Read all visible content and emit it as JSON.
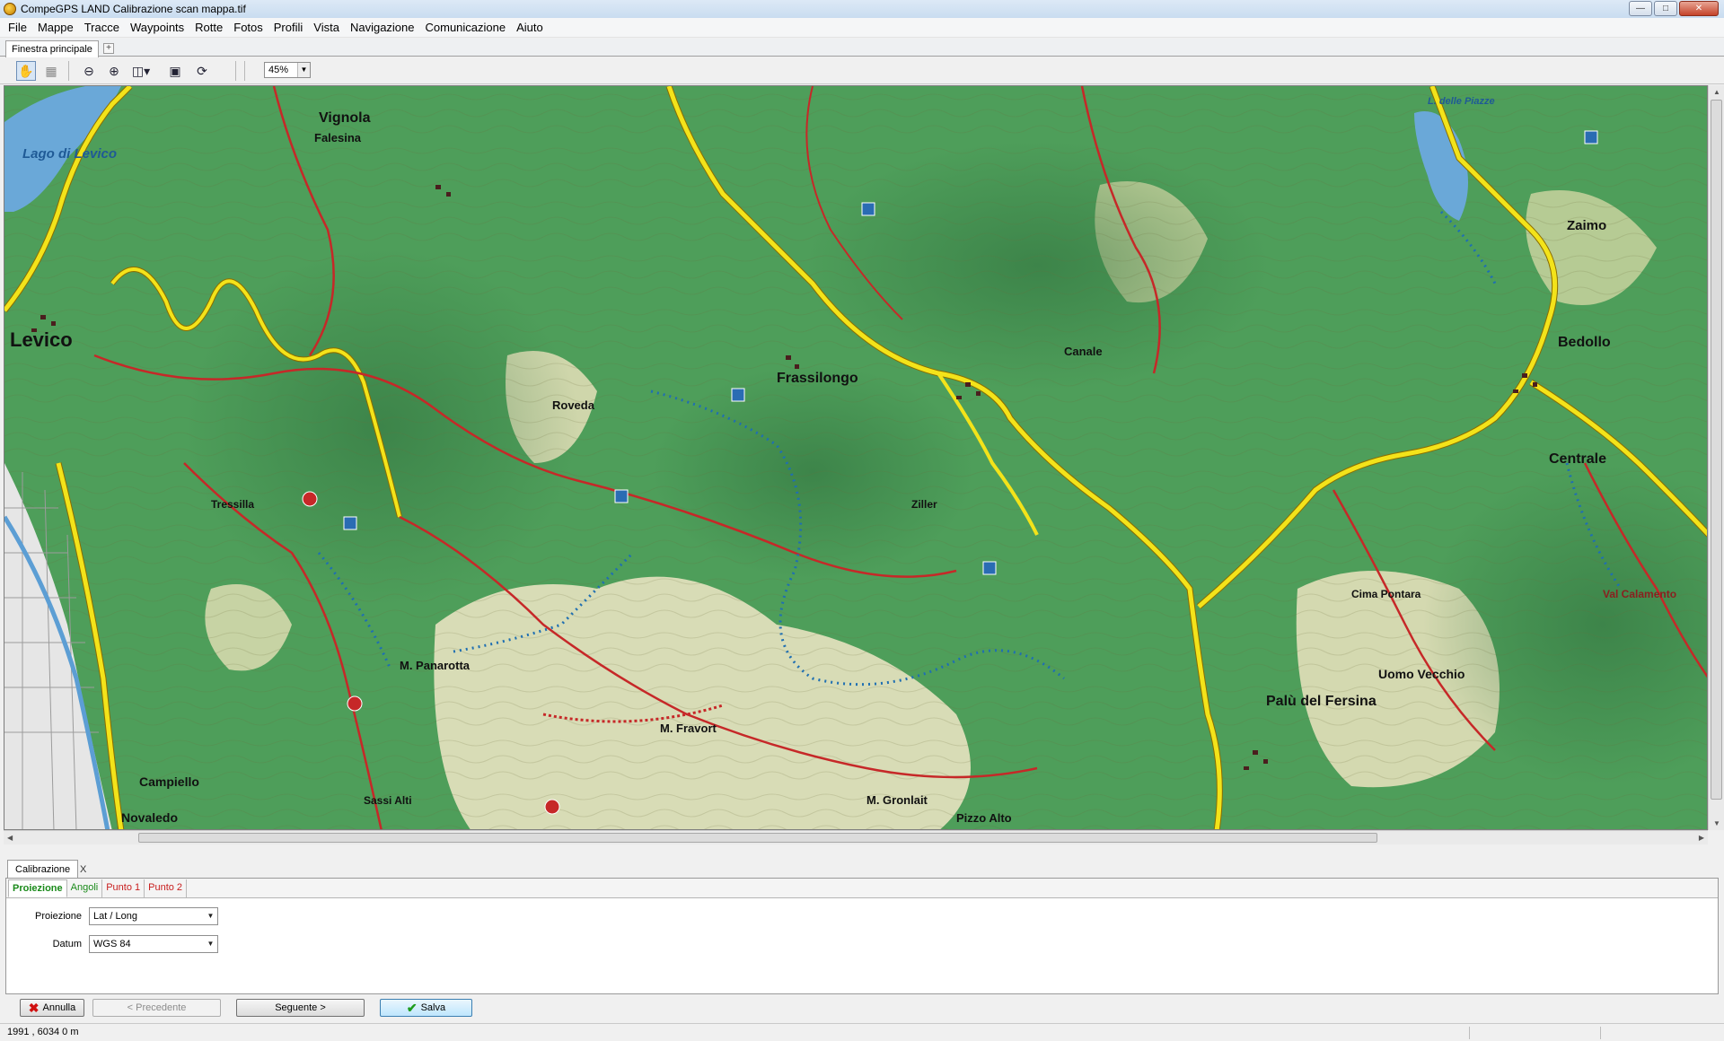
{
  "window": {
    "title": "CompeGPS LAND Calibrazione scan mappa.tif",
    "controls": [
      "minimize-icon",
      "maximize-icon",
      "close-icon"
    ]
  },
  "menu": [
    "File",
    "Mappe",
    "Tracce",
    "Waypoints",
    "Rotte",
    "Fotos",
    "Profili",
    "Vista",
    "Navigazione",
    "Comunicazione",
    "Aiuto"
  ],
  "main_tab": {
    "label": "Finestra principale",
    "add_label": "+"
  },
  "toolbar": {
    "zoom_value": "45%",
    "tools": [
      "hand-pan-icon",
      "select-icon",
      "zoom-out-icon",
      "zoom-in-icon",
      "zoom-window-icon",
      "map-view-icon",
      "refresh-icon"
    ]
  },
  "map": {
    "colors": {
      "forest": "#4e9e5a",
      "meadow": "#d9ddb6",
      "road": "#f3e31a",
      "trail": "#c62828",
      "path": "#1f6fb2",
      "water": "#6aa8d8"
    },
    "labels": [
      "Levico",
      "Lago di Levico",
      "Vignola",
      "Falesina",
      "Frassilongo",
      "Roveda",
      "Palù del Fersina",
      "Centrale",
      "Bedollo",
      "Zaimo",
      "M. Panarotta",
      "M. Fravort",
      "M. Gronlait",
      "Campiello",
      "Novaledo",
      "Uomo Vecchio",
      "Sassi Alti",
      "Canale",
      "Pizzo Alto",
      "Cima Pontara",
      "Val Calamento",
      "L. delle Piazze",
      "Ziller",
      "Tressilla"
    ]
  },
  "panel": {
    "tab_label": "Calibrazione",
    "close_label": "X",
    "subtabs": [
      "Proiezione",
      "Angoli",
      "Punto 1",
      "Punto 2"
    ],
    "fields": {
      "projection_label": "Proiezione",
      "projection_value": "Lat / Long",
      "datum_label": "Datum",
      "datum_value": "WGS 84"
    },
    "buttons": {
      "cancel": "Annulla",
      "previous": "< Precedente",
      "next": "Seguente >",
      "save": "Salva"
    }
  },
  "status": {
    "coords": "1991 , 6034  0 m"
  }
}
